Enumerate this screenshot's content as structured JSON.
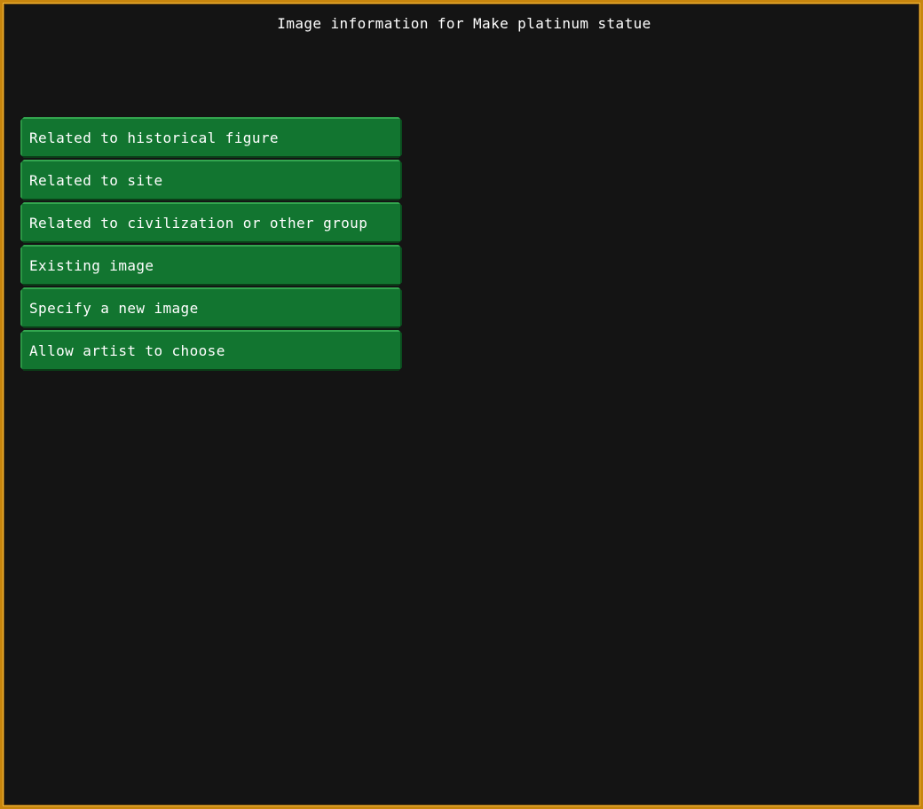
{
  "window": {
    "title": "Image information for Make platinum statue"
  },
  "menu": {
    "items": [
      {
        "label": "Related to historical figure"
      },
      {
        "label": "Related to site"
      },
      {
        "label": "Related to civilization or other group"
      },
      {
        "label": "Existing image"
      },
      {
        "label": "Specify a new image"
      },
      {
        "label": "Allow artist to choose"
      }
    ]
  },
  "colors": {
    "background": "#141414",
    "border": "#c8860e",
    "button": "#127530",
    "text": "#ffffff"
  }
}
